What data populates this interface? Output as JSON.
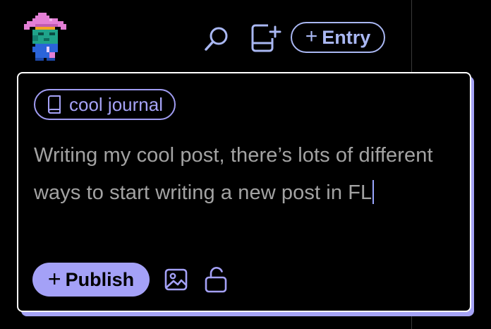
{
  "header": {
    "avatar_icon": "pixel-wizard-avatar",
    "search_icon": "search-icon",
    "new_document_icon": "new-document-icon",
    "entry_button": {
      "plus": "+",
      "label": "Entry"
    }
  },
  "composer": {
    "journal": {
      "icon": "book-icon",
      "name": "cool journal"
    },
    "text": "Writing my cool post, there’s lots of different ways to start writing a new post in FL",
    "publish_button": {
      "plus": "+",
      "label": "Publish"
    },
    "image_icon": "image-icon",
    "lock_icon": "unlock-icon"
  },
  "colors": {
    "background": "#000000",
    "accent": "#a4a1f7",
    "header_accent": "#a9b7f2",
    "text_muted": "#a3a3a3",
    "card_border": "#ffffff"
  }
}
